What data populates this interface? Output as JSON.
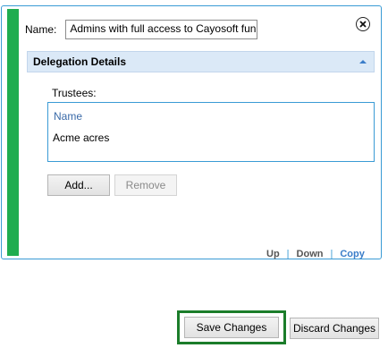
{
  "name_field": {
    "label": "Name:",
    "value": "Admins with full access to Cayosoft fun"
  },
  "section": {
    "title": "Delegation Details"
  },
  "trustees": {
    "label": "Trustees:",
    "column_header": "Name",
    "rows": [
      "Acme acres"
    ]
  },
  "buttons": {
    "add": "Add...",
    "remove": "Remove",
    "save": "Save Changes",
    "discard": "Discard Changes"
  },
  "footer": {
    "up": "Up",
    "down": "Down",
    "copy": "Copy",
    "separator": "|"
  },
  "colors": {
    "accent_green": "#1fad50",
    "border_blue": "#3a9bd5",
    "header_bg": "#dbe9f7",
    "save_highlight": "#1b7d2a"
  }
}
